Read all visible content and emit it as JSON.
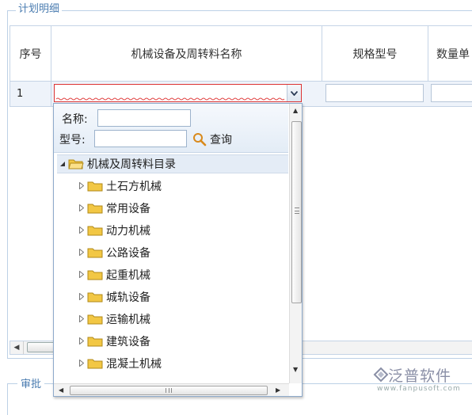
{
  "section": {
    "legend": "计划明细"
  },
  "grid": {
    "columns": [
      "序号",
      "机械设备及周转料名称",
      "规格型号",
      "数量单"
    ],
    "row": {
      "number": "1"
    }
  },
  "approval": {
    "legend": "审批"
  },
  "dropdown": {
    "name_label": "名称:",
    "model_label": "型号:",
    "search_label": "查询",
    "tree": {
      "root": "机械及周转料目录",
      "children": [
        "土石方机械",
        "常用设备",
        "动力机械",
        "公路设备",
        "起重机械",
        "城轨设备",
        "运输机械",
        "建筑设备",
        "混凝土机械"
      ]
    }
  },
  "watermark": {
    "name": "泛普软件",
    "url": "www.fanpusoft.com"
  },
  "colors": {
    "border": "#c5d4e6",
    "legend": "#4a7cb0",
    "folder": "#f2c744",
    "error_border": "#dd3333"
  }
}
